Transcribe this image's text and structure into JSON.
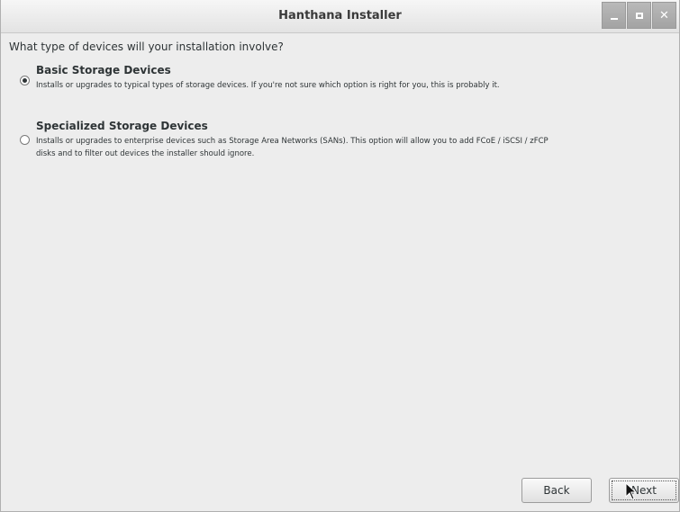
{
  "window": {
    "title": "Hanthana Installer"
  },
  "question": "What type of devices will your installation involve?",
  "options": [
    {
      "title": "Basic Storage Devices",
      "description": "Installs or upgrades to typical types of storage devices.  If you're not sure which option is right for you, this is probably it.",
      "selected": true
    },
    {
      "title": "Specialized Storage Devices",
      "description": "Installs or upgrades to enterprise devices such as Storage Area Networks (SANs). This option will allow you to add FCoE / iSCSI / zFCP disks and to filter out devices the installer should ignore.",
      "selected": false
    }
  ],
  "buttons": {
    "back": "Back",
    "next": "Next"
  },
  "icons": {
    "minimize": "minimize-icon",
    "maximize": "maximize-icon",
    "close": "close-icon",
    "cursor": "mouse-pointer-icon"
  }
}
